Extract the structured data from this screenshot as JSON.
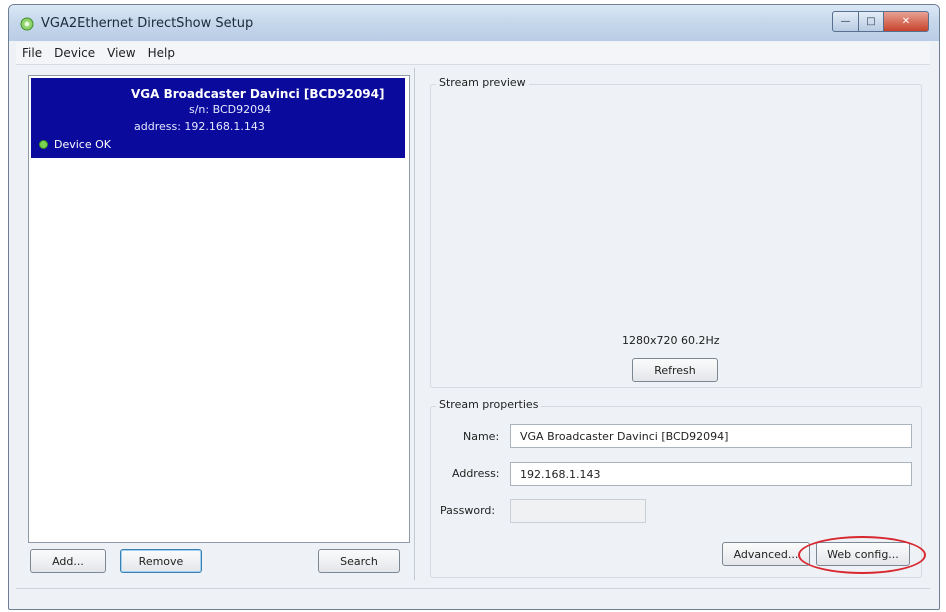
{
  "window": {
    "title": "VGA2Ethernet DirectShow Setup"
  },
  "menu": {
    "items": [
      "File",
      "Device",
      "View",
      "Help"
    ]
  },
  "devices": [
    {
      "name": "VGA Broadcaster Davinci [BCD92094]",
      "serial": "s/n: BCD92094",
      "address": "address: 192.168.1.143",
      "status": "Device OK"
    }
  ],
  "left_buttons": {
    "add": "Add...",
    "remove": "Remove",
    "search": "Search"
  },
  "preview": {
    "label": "Stream preview",
    "resolution": "1280x720 60.2Hz",
    "refresh": "Refresh"
  },
  "properties": {
    "label": "Stream properties",
    "name_label": "Name:",
    "name_value": "VGA Broadcaster Davinci [BCD92094]",
    "address_label": "Address:",
    "address_value": "192.168.1.143",
    "password_label": "Password:",
    "password_value": "",
    "advanced": "Advanced...",
    "web_config": "Web config..."
  },
  "colors": {
    "selection": "#0a0a9c",
    "status_ok": "#7ad451",
    "highlight_circle": "#d9272f"
  }
}
